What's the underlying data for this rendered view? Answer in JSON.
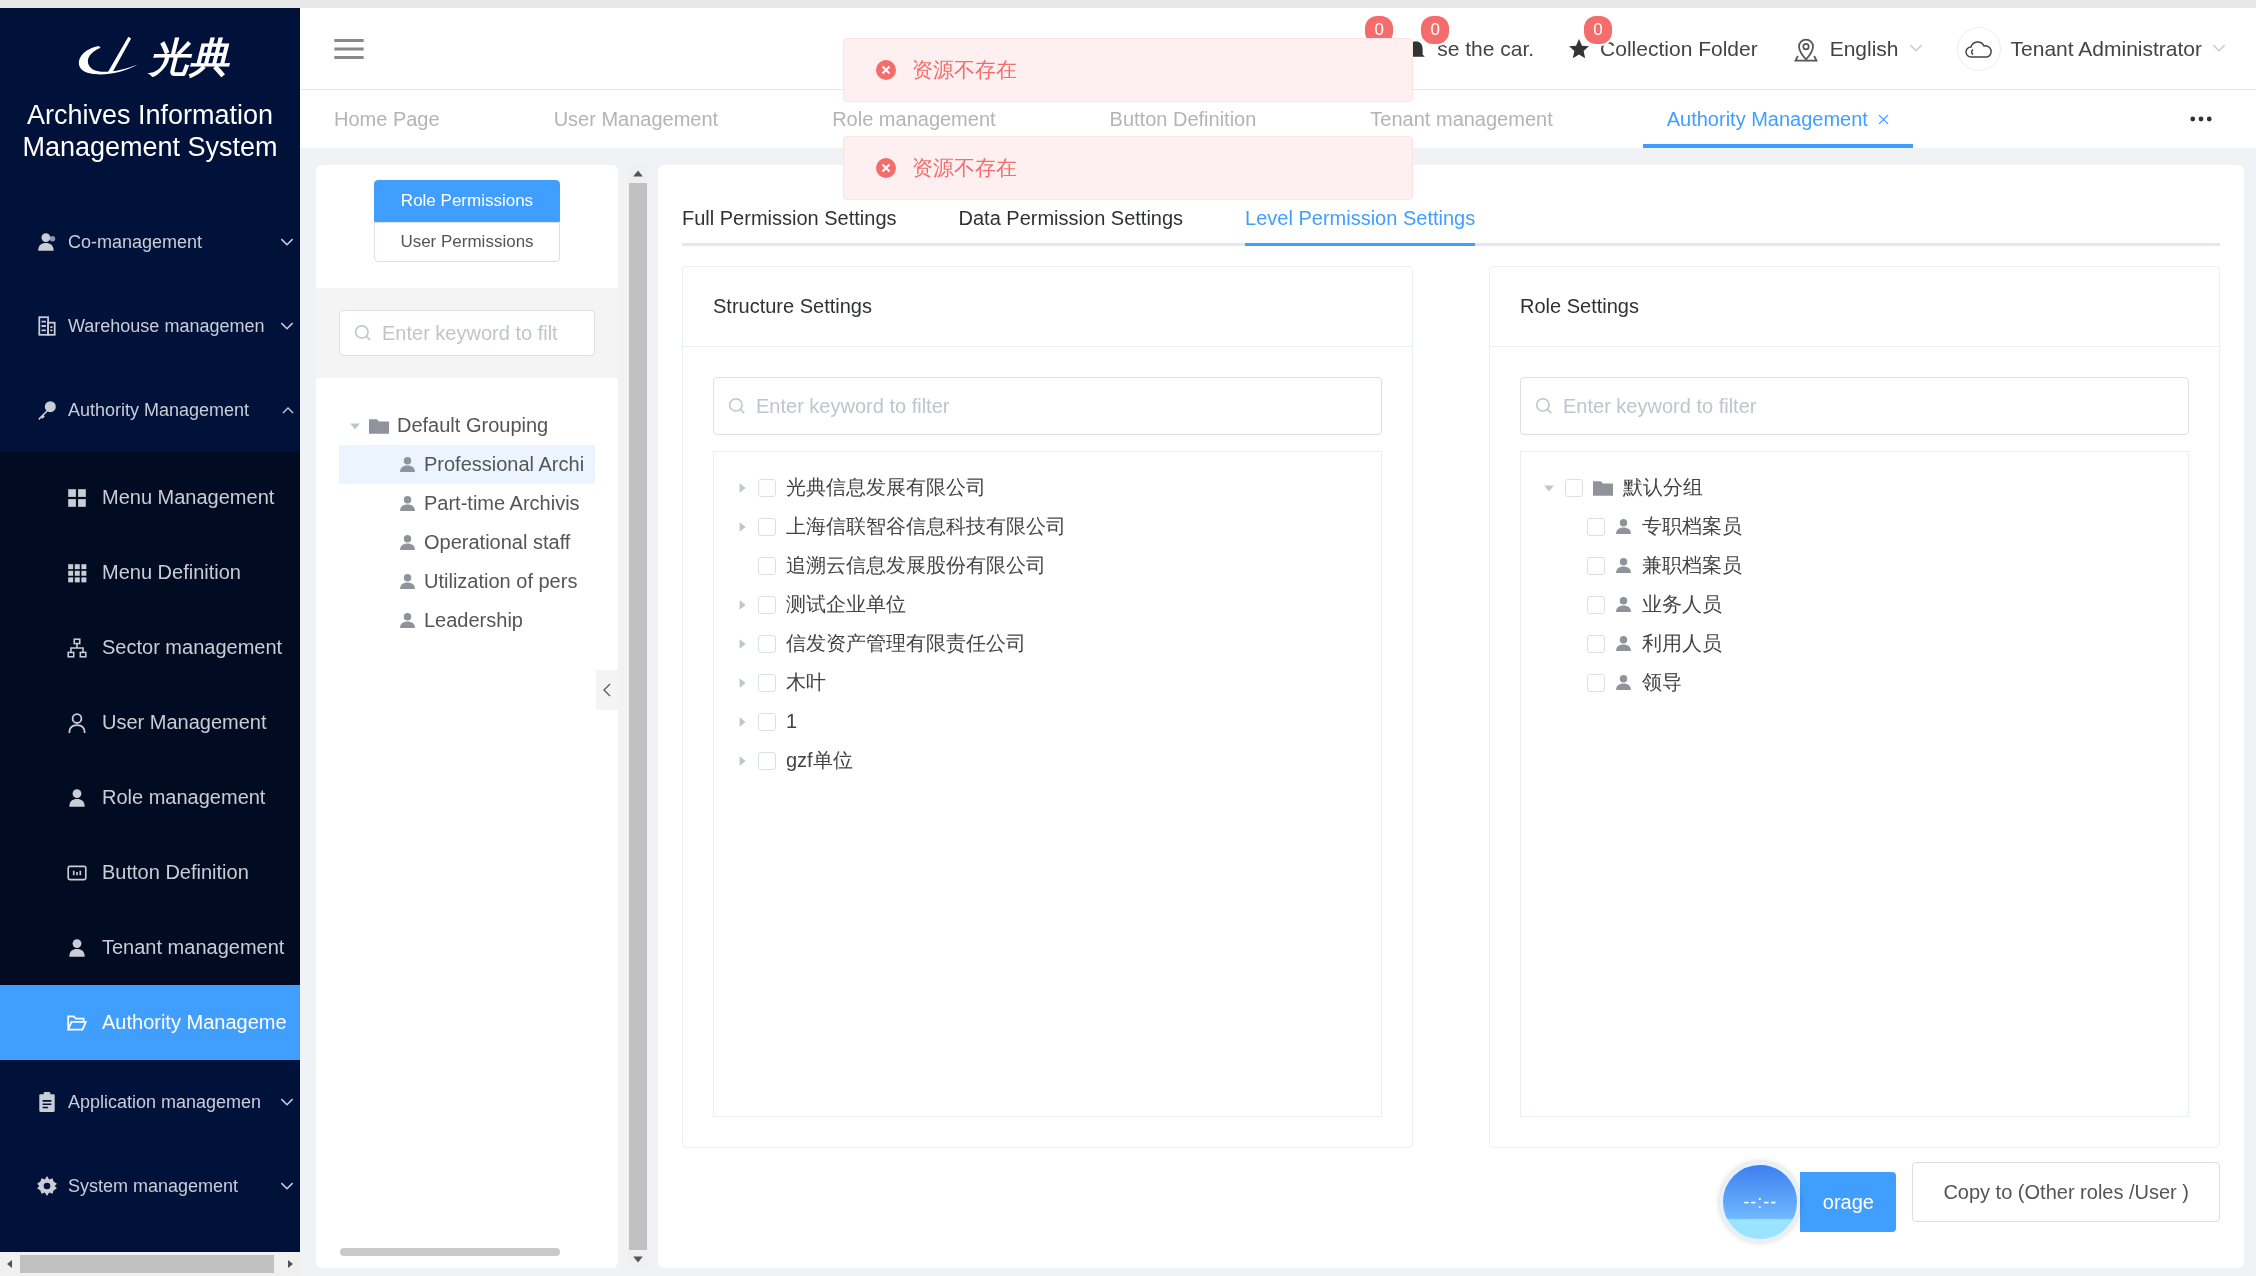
{
  "sidebar": {
    "logo_text": "光典",
    "title": "Archives Information Management System",
    "items": [
      {
        "label": "Co-management",
        "expanded": false,
        "selected": false
      },
      {
        "label": "Warehouse managemen",
        "expanded": false,
        "selected": false
      },
      {
        "label": "Authority Management",
        "expanded": true,
        "selected": false,
        "children": [
          {
            "label": "Menu Management",
            "selected": false
          },
          {
            "label": "Menu Definition",
            "selected": false
          },
          {
            "label": "Sector management",
            "selected": false
          },
          {
            "label": "User Management",
            "selected": false
          },
          {
            "label": "Role management",
            "selected": false
          },
          {
            "label": "Button Definition",
            "selected": false
          },
          {
            "label": "Tenant management",
            "selected": false
          },
          {
            "label": "Authority Manageme",
            "selected": true
          }
        ]
      },
      {
        "label": "Application managemen",
        "expanded": false,
        "selected": false
      },
      {
        "label": "System management",
        "expanded": false,
        "selected": false
      }
    ]
  },
  "header": {
    "notifications": [
      {
        "badge": "0"
      },
      {
        "badge": "0",
        "label": "se the car."
      }
    ],
    "collection": {
      "label": "Collection Folder",
      "badge": "0"
    },
    "language": "English",
    "user": "Tenant Administrator"
  },
  "tabs": [
    {
      "label": "Home Page",
      "selected": false,
      "closable": false
    },
    {
      "label": "User Management",
      "selected": false,
      "closable": false
    },
    {
      "label": "Role management",
      "selected": false,
      "closable": false
    },
    {
      "label": "Button Definition",
      "selected": false,
      "closable": false
    },
    {
      "label": "Tenant management",
      "selected": false,
      "closable": false
    },
    {
      "label": "Authority Management",
      "selected": true,
      "closable": true
    }
  ],
  "toasts": [
    {
      "message": "资源不存在"
    },
    {
      "message": "资源不存在"
    }
  ],
  "left_panel": {
    "modes": [
      {
        "label": "Role Permissions",
        "selected": true
      },
      {
        "label": "User Permissions",
        "selected": false
      }
    ],
    "search": {
      "placeholder": "Enter keyword to filt"
    },
    "tree": [
      {
        "label": "Default Grouping",
        "expanded": true,
        "selected": false,
        "children": [
          {
            "label": "Professional Archi",
            "selected": true
          },
          {
            "label": "Part-time Archivis",
            "selected": false
          },
          {
            "label": "Operational staff",
            "selected": false
          },
          {
            "label": "Utilization of pers",
            "selected": false
          },
          {
            "label": "Leadership",
            "selected": false
          }
        ]
      }
    ]
  },
  "settings_tabs": [
    {
      "label": "Full Permission Settings",
      "selected": false
    },
    {
      "label": "Data Permission Settings",
      "selected": false
    },
    {
      "label": "Level Permission Settings",
      "selected": true
    }
  ],
  "structure": {
    "title": "Structure Settings",
    "search": {
      "placeholder": "Enter keyword to filter"
    },
    "tree": [
      {
        "label": "光典信息发展有限公司",
        "checked": false,
        "expanded": false
      },
      {
        "label": "上海信联智谷信息科技有限公司",
        "checked": false,
        "expanded": false
      },
      {
        "label": "追溯云信息发展股份有限公司",
        "checked": false
      },
      {
        "label": "测试企业单位",
        "checked": false,
        "expanded": false
      },
      {
        "label": "信发资产管理有限责任公司",
        "checked": false,
        "expanded": false
      },
      {
        "label": "木叶",
        "checked": false,
        "expanded": false
      },
      {
        "label": "1",
        "checked": false,
        "expanded": false
      },
      {
        "label": "gzf单位",
        "checked": false,
        "expanded": false
      }
    ]
  },
  "roles": {
    "title": "Role Settings",
    "search": {
      "placeholder": "Enter keyword to filter"
    },
    "tree": [
      {
        "label": "默认分组",
        "checked": false,
        "expanded": true,
        "children": [
          {
            "label": "专职档案员",
            "checked": false
          },
          {
            "label": "兼职档案员",
            "checked": false
          },
          {
            "label": "业务人员",
            "checked": false
          },
          {
            "label": "利用人员",
            "checked": false
          },
          {
            "label": "领导",
            "checked": false
          }
        ]
      }
    ]
  },
  "buttons": {
    "save": "orage",
    "copy": "Copy to (Other roles /User )"
  },
  "clock": "--:--"
}
